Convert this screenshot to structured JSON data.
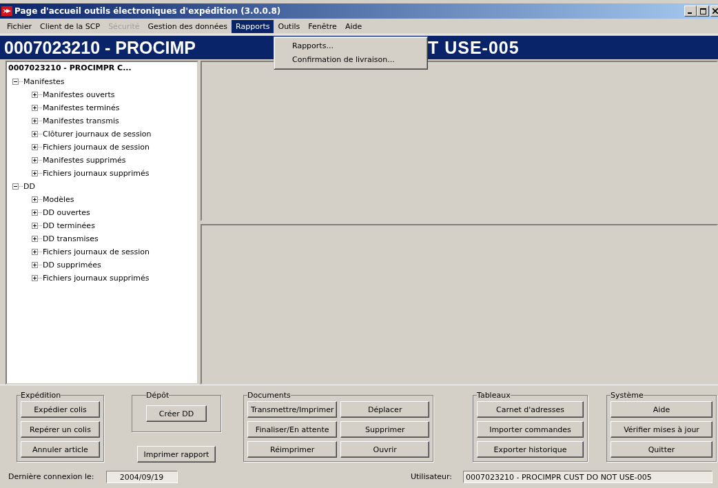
{
  "window": {
    "title": "Page d'accueil outils électroniques d'expédition (3.0.0.8)"
  },
  "menu_bar": [
    {
      "label": "Fichier",
      "disabled": false,
      "selected": false
    },
    {
      "label": "Client de la SCP",
      "disabled": false,
      "selected": false
    },
    {
      "label": "Sécurité",
      "disabled": true,
      "selected": false
    },
    {
      "label": "Gestion des données",
      "disabled": false,
      "selected": false
    },
    {
      "label": "Rapports",
      "disabled": false,
      "selected": true
    },
    {
      "label": "Outils",
      "disabled": false,
      "selected": false
    },
    {
      "label": "Fenêtre",
      "disabled": false,
      "selected": false
    },
    {
      "label": "Aide",
      "disabled": false,
      "selected": false
    }
  ],
  "dropdown": [
    "Rapports...",
    "Confirmation de livraison..."
  ],
  "banner": {
    "text_left": "0007023210 - PROCIMP",
    "text_right": "T USE-005"
  },
  "tree": {
    "root": "0007023210 - PROCIMPR C...",
    "children": [
      {
        "label": "Manifestes",
        "expanded": true,
        "children": [
          {
            "label": "Manifestes ouverts",
            "expanded": false
          },
          {
            "label": "Manifestes terminés",
            "expanded": false
          },
          {
            "label": "Manifestes transmis",
            "expanded": false
          },
          {
            "label": "Clôturer journaux de session",
            "expanded": false
          },
          {
            "label": "Fichiers journaux de session",
            "expanded": false
          },
          {
            "label": "Manifestes supprimés",
            "expanded": false
          },
          {
            "label": "Fichiers journaux supprimés",
            "expanded": false
          }
        ]
      },
      {
        "label": "DD",
        "expanded": true,
        "children": [
          {
            "label": "Modèles",
            "expanded": false
          },
          {
            "label": "DD ouvertes",
            "expanded": false
          },
          {
            "label": "DD terminées",
            "expanded": false
          },
          {
            "label": "DD transmises",
            "expanded": false
          },
          {
            "label": "Fichiers journaux de session",
            "expanded": false
          },
          {
            "label": "DD supprimées",
            "expanded": false
          },
          {
            "label": "Fichiers journaux supprimés",
            "expanded": false
          }
        ]
      }
    ]
  },
  "groups": [
    {
      "title": "Expédition",
      "buttons": [
        "Expédier colis",
        "Repérer un colis",
        "Annuler article"
      ]
    },
    {
      "title": "Dépôt",
      "buttons": [
        "Créer DD"
      ],
      "extra_button": "Imprimer rapport"
    },
    {
      "title": "Documents",
      "buttons": [
        "Transmettre/Imprimer",
        "Déplacer",
        "Finaliser/En attente",
        "Supprimer",
        "Réimprimer",
        "Ouvrir"
      ]
    },
    {
      "title": "Tableaux",
      "buttons": [
        "Carnet d'adresses",
        "Importer commandes",
        "Exporter historique"
      ]
    },
    {
      "title": "Système",
      "buttons": [
        "Aide",
        "Vérifier mises à jour",
        "Quitter"
      ]
    }
  ],
  "status_bar": {
    "last_login_label": "Dernière connexion le:",
    "last_login": "2004/09/19",
    "user_label": "Utilisateur:",
    "user": "0007023210 - PROCIMPR CUST DO NOT USE-005"
  }
}
